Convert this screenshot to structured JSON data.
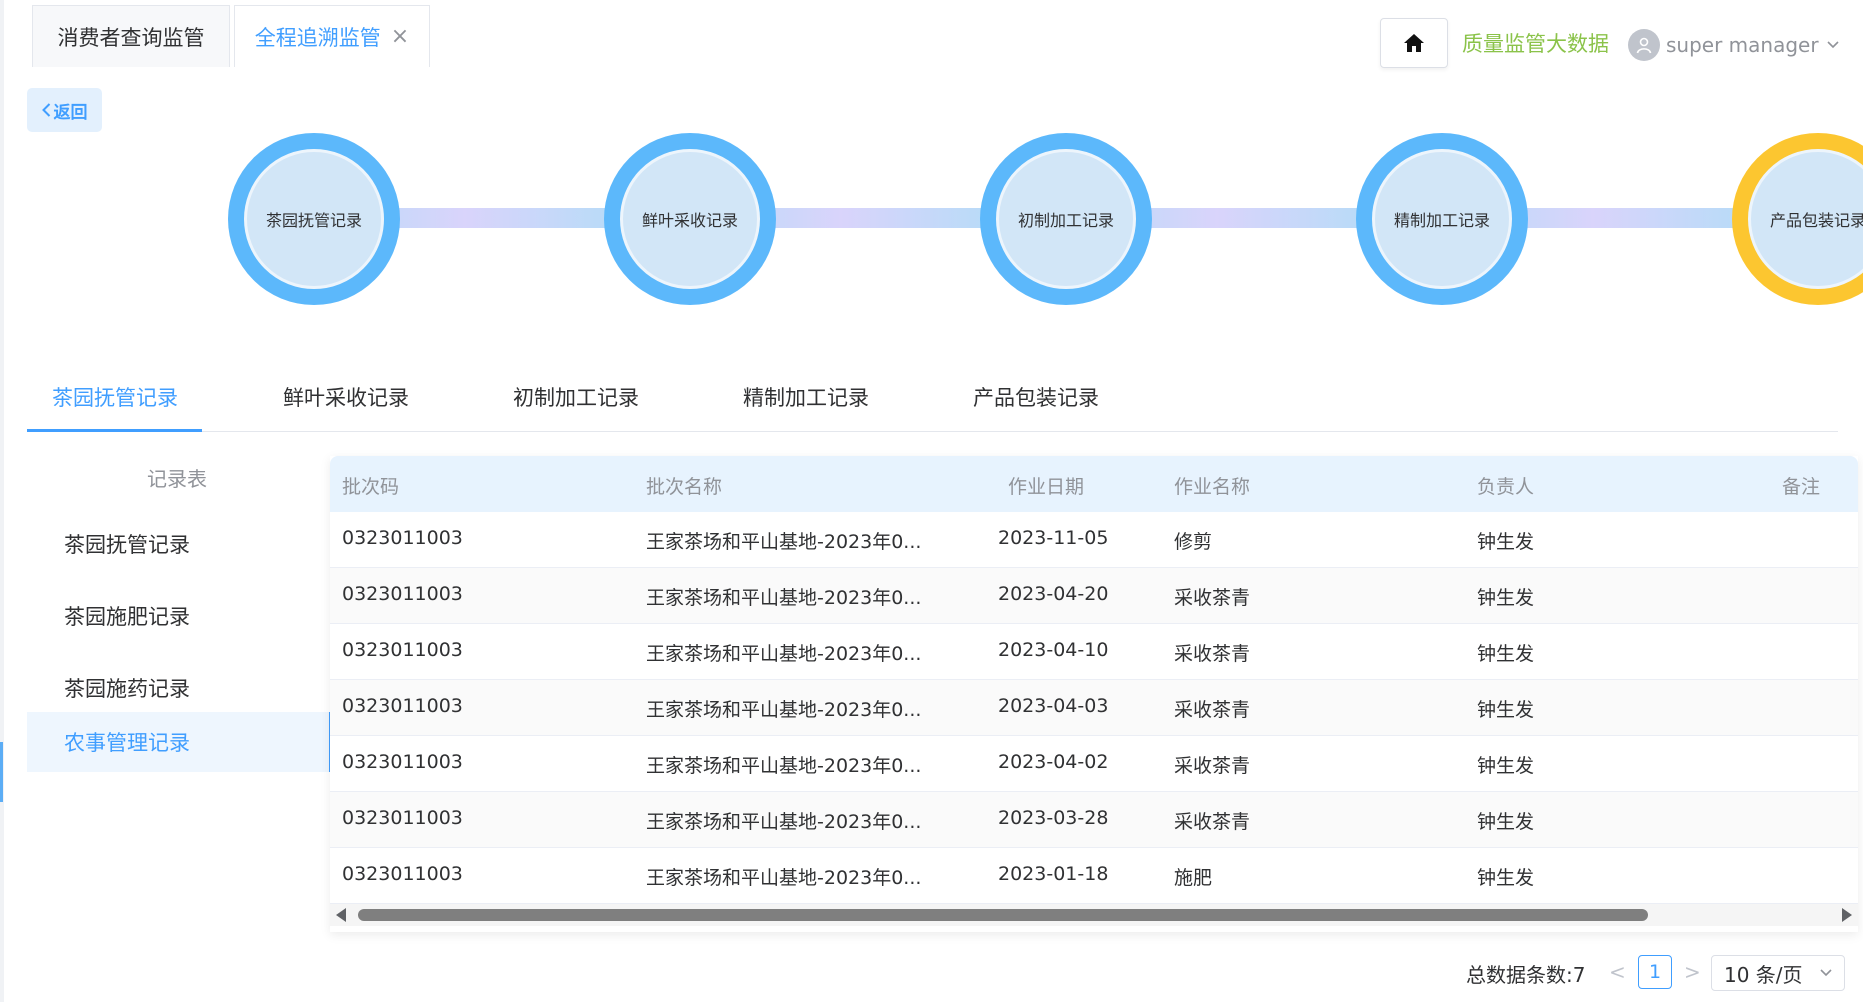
{
  "top_tabs": [
    {
      "label": "消费者查询监管"
    },
    {
      "label": "全程追溯监管",
      "close": "×"
    }
  ],
  "header": {
    "home_icon": "home-icon",
    "bigdata_link": "质量监管大数据",
    "user_name": "super manager",
    "user_icon": "user-icon",
    "accent_color": "#409eff",
    "bigdata_color": "#8bc34a"
  },
  "back_button": "返回",
  "timeline": {
    "steps": [
      {
        "label": "茶园抚管记录"
      },
      {
        "label": "鲜叶采收记录"
      },
      {
        "label": "初制加工记录"
      },
      {
        "label": "精制加工记录"
      },
      {
        "label": "产品包装记录"
      }
    ],
    "step_color": "#5cb8fb",
    "active_step_color": "#fcc630"
  },
  "record_tabs": [
    {
      "label": "茶园抚管记录"
    },
    {
      "label": "鲜叶采收记录"
    },
    {
      "label": "初制加工记录"
    },
    {
      "label": "精制加工记录"
    },
    {
      "label": "产品包装记录"
    }
  ],
  "side_panel": {
    "title": "记录表",
    "items": [
      {
        "label": "茶园抚管记录"
      },
      {
        "label": "茶园施肥记录"
      },
      {
        "label": "茶园施药记录"
      },
      {
        "label": "农事管理记录"
      }
    ]
  },
  "table": {
    "columns": [
      "批次码",
      "批次名称",
      "作业日期",
      "作业名称",
      "负责人",
      "备注"
    ],
    "rows": [
      {
        "code": "0323011003",
        "name": "王家茶场和平山基地-2023年0...",
        "date": "2023-11-05",
        "job": "修剪",
        "owner": "钟生发",
        "note": ""
      },
      {
        "code": "0323011003",
        "name": "王家茶场和平山基地-2023年0...",
        "date": "2023-04-20",
        "job": "采收茶青",
        "owner": "钟生发",
        "note": ""
      },
      {
        "code": "0323011003",
        "name": "王家茶场和平山基地-2023年0...",
        "date": "2023-04-10",
        "job": "采收茶青",
        "owner": "钟生发",
        "note": ""
      },
      {
        "code": "0323011003",
        "name": "王家茶场和平山基地-2023年0...",
        "date": "2023-04-03",
        "job": "采收茶青",
        "owner": "钟生发",
        "note": ""
      },
      {
        "code": "0323011003",
        "name": "王家茶场和平山基地-2023年0...",
        "date": "2023-04-02",
        "job": "采收茶青",
        "owner": "钟生发",
        "note": ""
      },
      {
        "code": "0323011003",
        "name": "王家茶场和平山基地-2023年0...",
        "date": "2023-03-28",
        "job": "采收茶青",
        "owner": "钟生发",
        "note": ""
      },
      {
        "code": "0323011003",
        "name": "王家茶场和平山基地-2023年0...",
        "date": "2023-01-18",
        "job": "施肥",
        "owner": "钟生发",
        "note": ""
      }
    ]
  },
  "pagination": {
    "total": "总数据条数:7",
    "prev": "<",
    "page": "1",
    "next": ">",
    "page_size": "10 条/页"
  }
}
